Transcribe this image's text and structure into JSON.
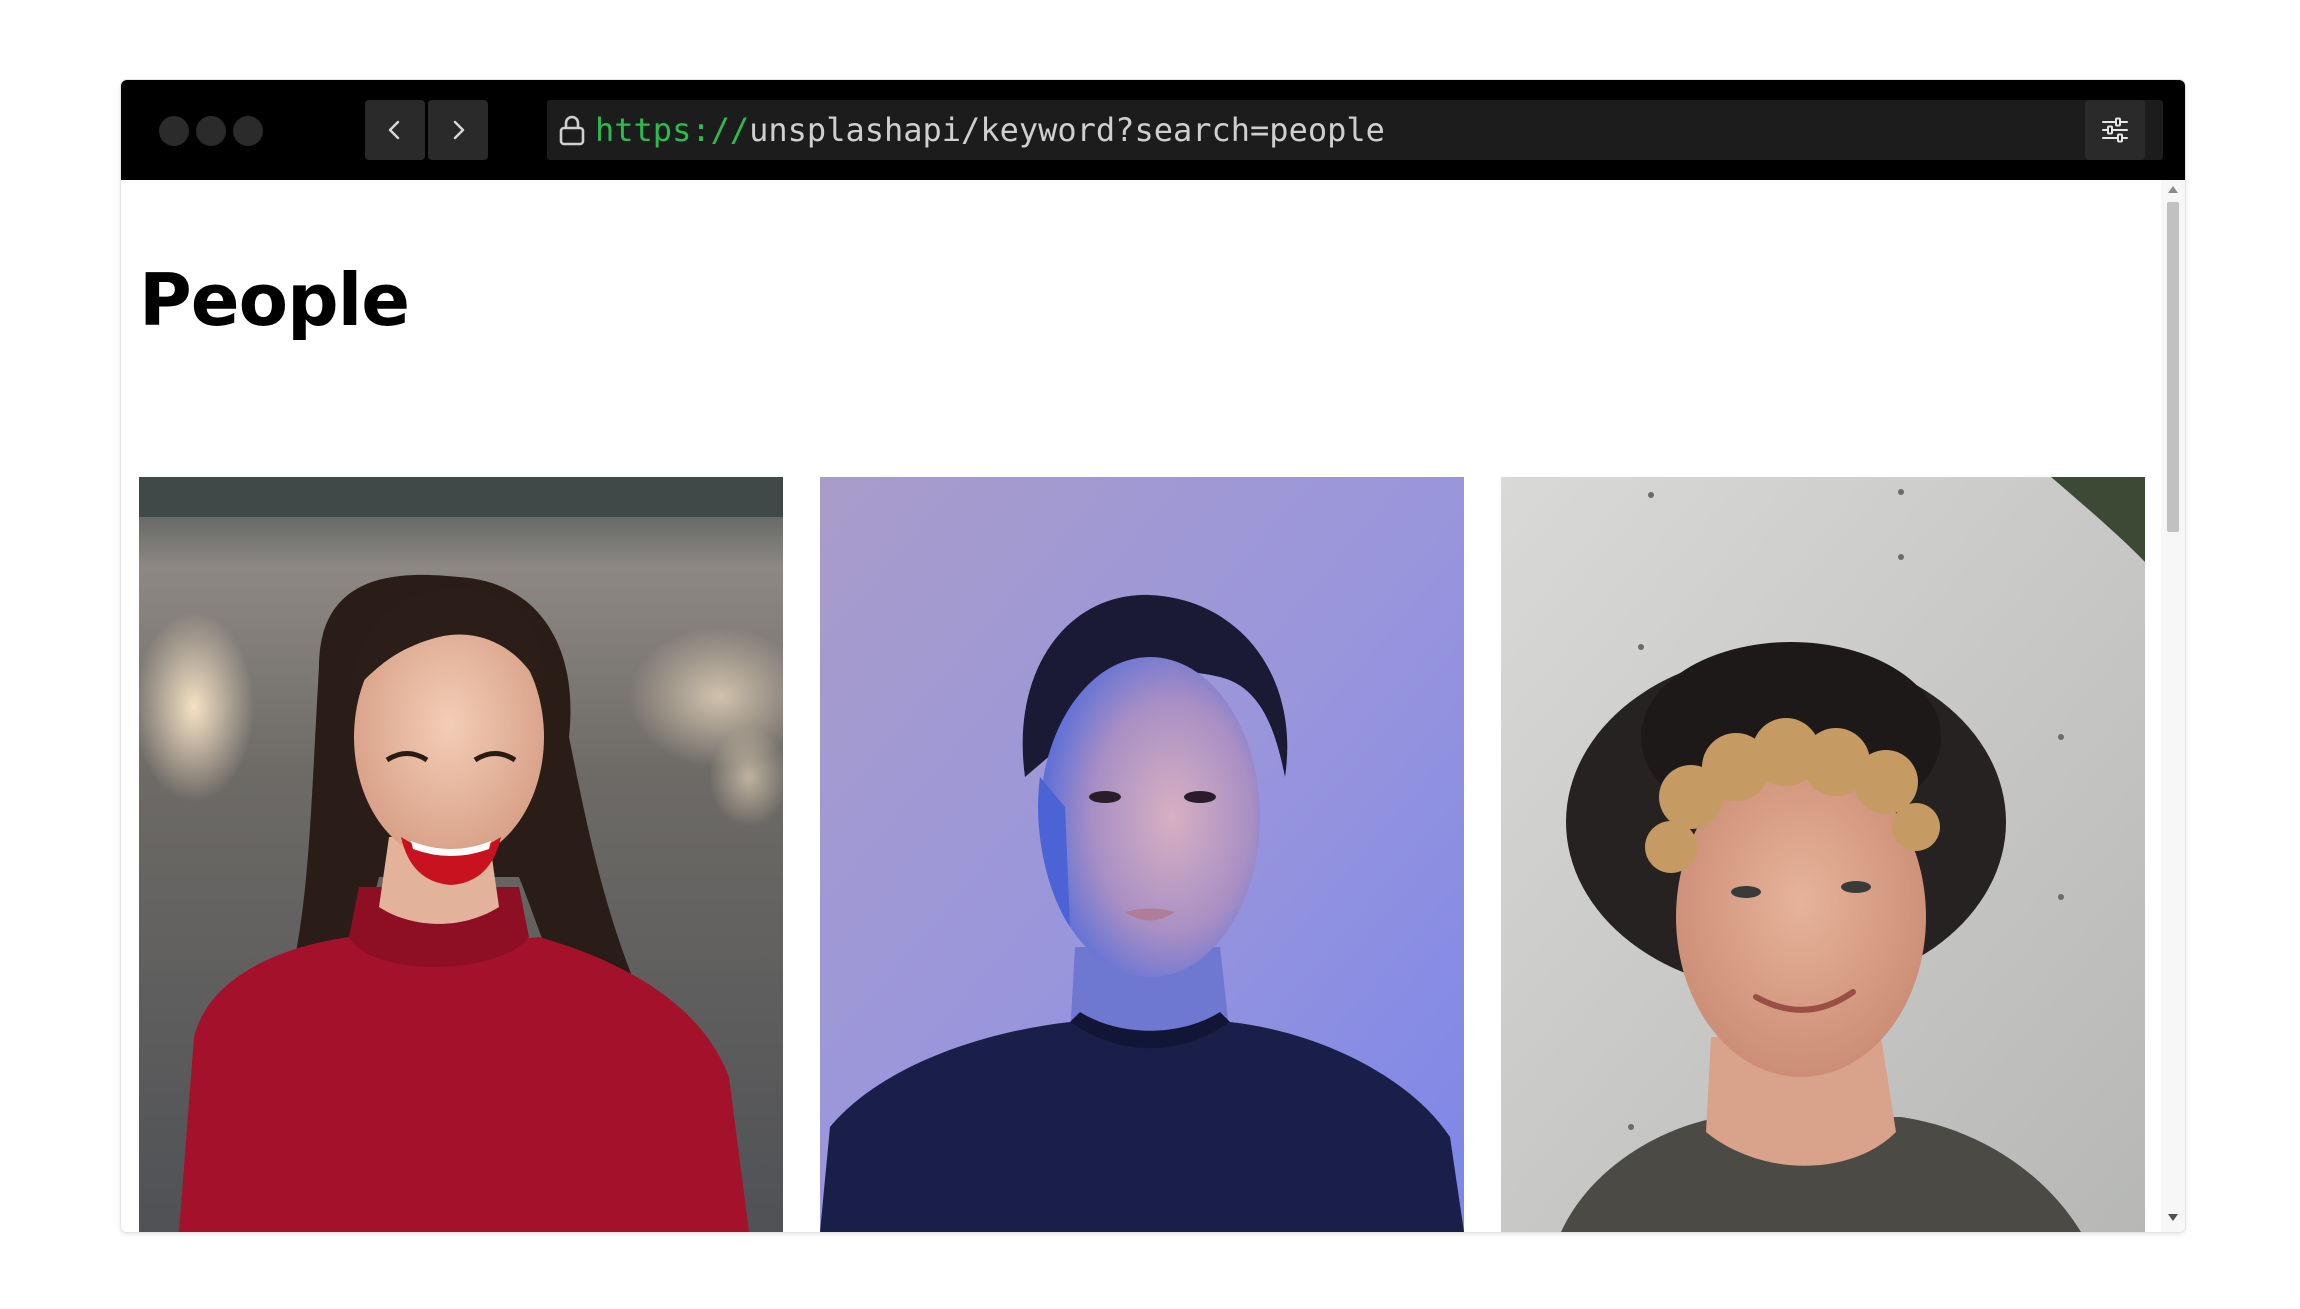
{
  "browser": {
    "url_scheme": "https://",
    "url_rest": "unsplashapi/keyword?search=people",
    "icons": {
      "back": "chevron-left-icon",
      "forward": "chevron-right-icon",
      "lock": "lock-icon",
      "settings": "sliders-icon"
    }
  },
  "page": {
    "title": "People",
    "photos": [
      {
        "alt": "smiling woman with red lips in red sweater"
      },
      {
        "alt": "woman with short dark hair lit in blue and purple"
      },
      {
        "alt": "curly-haired young man in black hat"
      }
    ]
  }
}
